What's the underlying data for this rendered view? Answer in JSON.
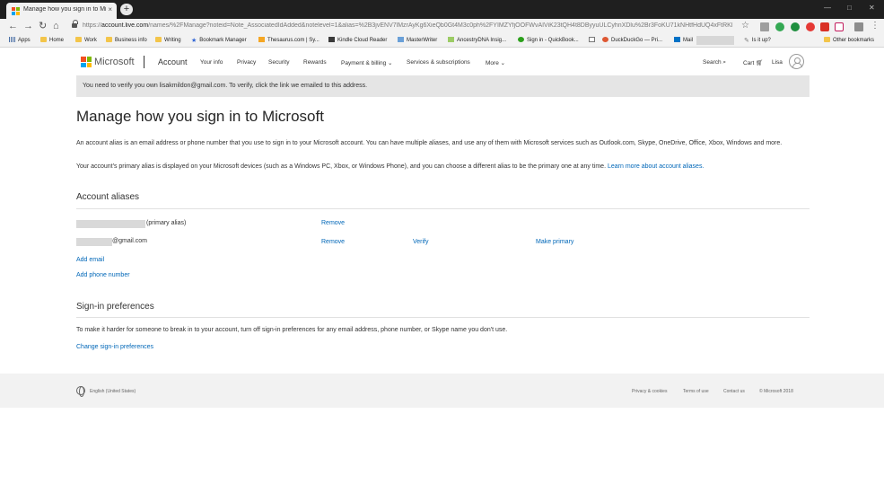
{
  "browser": {
    "tab_title": "Manage how you sign in to Mic",
    "tab_close": "×",
    "new_tab": "+",
    "window_min": "—",
    "window_max": "□",
    "window_close": "✕",
    "url_prefix": "https://",
    "url_host": "account.live.com",
    "url_rest": "/names/%2FManage?noteid=Note_AssociatedIdAdded&notelevel=1&alias=%2B3jvENV7lMzrAyKg6XieQb0Gt4M3c0ph%2FYIMZYfjOOFWvAIViK23tQH4t8DByyuULCyhnXDlu%2Br3FoKU71kNHtfHdUQ4xFtRKl",
    "bookmarks": [
      {
        "label": "Apps",
        "icon": "apps-grid-icon"
      },
      {
        "label": "Home",
        "icon": "folder-icon"
      },
      {
        "label": "Work",
        "icon": "folder-icon"
      },
      {
        "label": "Business info",
        "icon": "folder-icon"
      },
      {
        "label": "Writing",
        "icon": "folder-icon"
      },
      {
        "label": "Bookmark Manager",
        "icon": "star-icon"
      },
      {
        "label": "Thesaurus.com | Sy...",
        "icon": "thesaurus-icon"
      },
      {
        "label": "Kindle Cloud Reader",
        "icon": "kindle-icon"
      },
      {
        "label": "MasterWriter",
        "icon": "masterwriter-icon"
      },
      {
        "label": "AncestryDNA Insig...",
        "icon": "ancestry-icon"
      },
      {
        "label": "Sign in - QuickBook...",
        "icon": "quickbooks-icon"
      },
      {
        "label": "",
        "icon": "page-icon"
      },
      {
        "label": "DuckDuckGo — Pri...",
        "icon": "duckduckgo-icon"
      },
      {
        "label": "Mail",
        "icon": "outlook-mail-icon"
      },
      {
        "label": "Is it up?",
        "icon": "wrench-icon"
      },
      {
        "label": "Other bookmarks",
        "icon": "folder-icon"
      }
    ]
  },
  "header": {
    "brand": "Microsoft",
    "account": "Account",
    "nav": [
      "Your info",
      "Privacy",
      "Security",
      "Rewards",
      "Payment & billing ⌄",
      "Services & subscriptions",
      "More ⌄"
    ],
    "search": "Search",
    "cart": "Cart",
    "user": "Lisa"
  },
  "banner": "You need to verify you own lisakmildon@gmail.com. To verify, click the link we emailed to this address.",
  "main": {
    "title": "Manage how you sign in to Microsoft",
    "intro": "An account alias is an email address or phone number that you use to sign in to your Microsoft account. You can have multiple aliases, and use any of them with Microsoft services such as Outlook.com, Skype, OneDrive, Office, Xbox, Windows and more.",
    "primary_text": "Your account's primary alias is displayed on your Microsoft devices (such as a Windows PC, Xbox, or Windows Phone), and you can choose a different alias to be the primary one at any time.",
    "learn_more": "Learn more about account aliases."
  },
  "aliases": {
    "heading": "Account aliases",
    "rows": [
      {
        "suffix": "(primary alias)",
        "remove": "Remove"
      },
      {
        "suffix": "@gmail.com",
        "remove": "Remove",
        "verify": "Verify",
        "make_primary": "Make primary"
      }
    ],
    "add_email": "Add email",
    "add_phone": "Add phone number"
  },
  "signin": {
    "heading": "Sign-in preferences",
    "text": "To make it harder for someone to break in to your account, turn off sign-in preferences for any email address, phone number, or Skype name you don't use.",
    "link": "Change sign-in preferences"
  },
  "footer": {
    "locale": "English (United States)",
    "links": [
      "Privacy & cookies",
      "Terms of use",
      "Contact us",
      "© Microsoft 2018"
    ]
  },
  "colors": {
    "link": "#0067b8",
    "banner": "#e5e5e5",
    "footer": "#f2f2f2"
  }
}
